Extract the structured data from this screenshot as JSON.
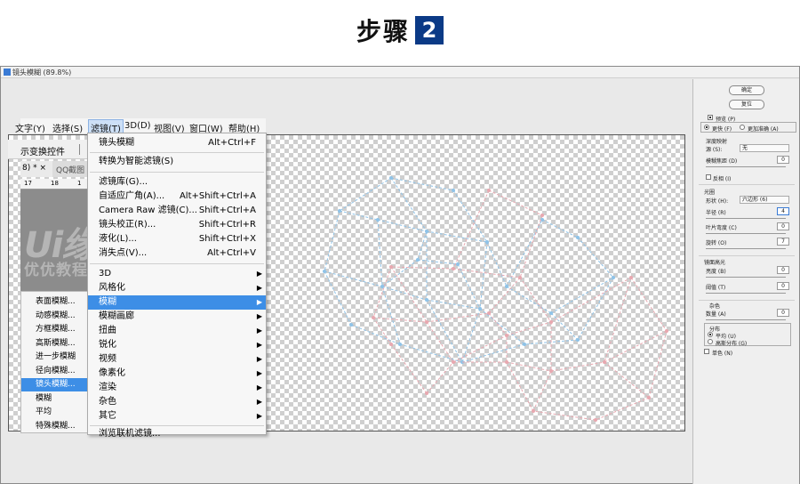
{
  "step": {
    "title": "步骤",
    "number": "2"
  },
  "window": {
    "title": "镜头模糊 (89.8%)"
  },
  "menubar": {
    "items": [
      "文字(Y)",
      "选择(S)",
      "滤镜(T)",
      "3D(D)",
      "视图(V)",
      "窗口(W)",
      "帮助(H)"
    ],
    "partial_first": "文字(Y)"
  },
  "toolbar": {
    "transform_label": "示变换控件"
  },
  "tabs": {
    "doc": "8) * ×",
    "qq": "QQ截图"
  },
  "ruler": {
    "a": "17",
    "b": "18",
    "c": "1"
  },
  "watermark": {
    "logo": "Ui缘",
    "text": "优优教程网"
  },
  "blur_submenu": [
    "表面模糊...",
    "动感模糊...",
    "方框模糊...",
    "高斯模糊...",
    "进一步模糊",
    "径向模糊...",
    "镜头模糊...",
    "模糊",
    "平均",
    "特殊模糊..."
  ],
  "filter_menu": {
    "last_filter": {
      "label": "镜头模糊",
      "shortcut": "Alt+Ctrl+F"
    },
    "smart": "转换为智能滤镜(S)",
    "items": [
      {
        "label": "滤镜库(G)...",
        "shortcut": ""
      },
      {
        "label": "自适应广角(A)...",
        "shortcut": "Alt+Shift+Ctrl+A"
      },
      {
        "label": "Camera Raw 滤镜(C)...",
        "shortcut": "Shift+Ctrl+A"
      },
      {
        "label": "镜头校正(R)...",
        "shortcut": "Shift+Ctrl+R"
      },
      {
        "label": "液化(L)...",
        "shortcut": "Shift+Ctrl+X"
      },
      {
        "label": "消失点(V)...",
        "shortcut": "Alt+Ctrl+V"
      }
    ],
    "groups": [
      "3D",
      "风格化",
      "模糊",
      "模糊画廊",
      "扭曲",
      "锐化",
      "视频",
      "像素化",
      "渲染",
      "杂色",
      "其它"
    ],
    "browse": "浏览联机滤镜..."
  },
  "panel": {
    "ok": "确定",
    "reset": "复位",
    "preview": "预览 (P)",
    "faster": "更快 (F)",
    "more_accurate": "更加准确 (A)",
    "depth_map": "深度映射",
    "source_label": "源 (S):",
    "source_value": "无",
    "blur_focal": "模糊焦距 (D)",
    "blur_focal_value": "0",
    "invert": "反相 (I)",
    "iris": "光圈",
    "shape_label": "形状 (H):",
    "shape_value": "六边形 (6)",
    "radius_label": "半径 (R)",
    "radius_value": "4",
    "blade_label": "叶片弯度 (C)",
    "blade_value": "0",
    "rotation_label": "旋转 (O)",
    "rotation_value": "7",
    "specular": "镜面高光",
    "brightness_label": "亮度 (B)",
    "brightness_value": "0",
    "threshold_label": "阈值 (T)",
    "threshold_value": "0",
    "noise": "杂色",
    "amount_label": "数量 (A)",
    "amount_value": "0",
    "distribution": "分布",
    "uniform": "平均 (U)",
    "gaussian": "高斯分布 (G)",
    "mono": "单色 (N)"
  },
  "colors": {
    "accent": "#3d8ee6",
    "step_badge": "#0b3a86",
    "blue_mesh": "#8fc3e8",
    "red_mesh": "#e8a8b0"
  }
}
